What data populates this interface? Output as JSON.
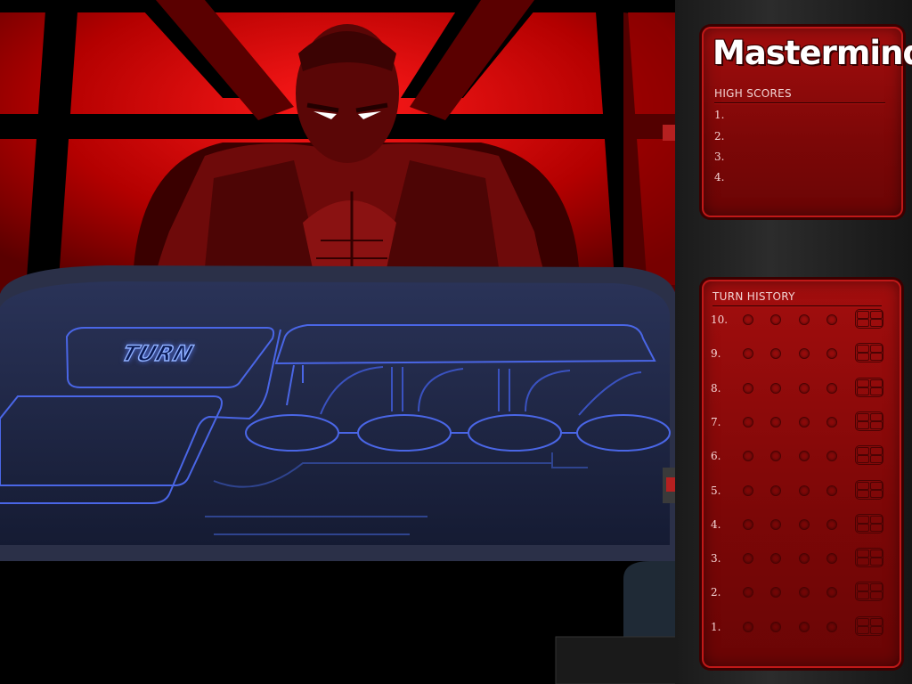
{
  "game": {
    "title": "Mastermind",
    "board_label": "TURN"
  },
  "high_scores": {
    "title": "HIGH SCORES",
    "entries": [
      "1.",
      "2.",
      "3.",
      "4."
    ]
  },
  "turn_history": {
    "title": "TURN HISTORY",
    "rows": [
      "10.",
      "9.",
      "8.",
      "7.",
      "6.",
      "5.",
      "4.",
      "3.",
      "2.",
      "1."
    ]
  },
  "colors": {
    "panel_red": "#8f0b0b",
    "board_blue": "#1c2544",
    "neon_blue": "#5a7cff",
    "bg_red": "#c20000"
  },
  "icons": {
    "peg": "empty-peg-hole-icon",
    "feedback": "feedback-grid-icon"
  }
}
